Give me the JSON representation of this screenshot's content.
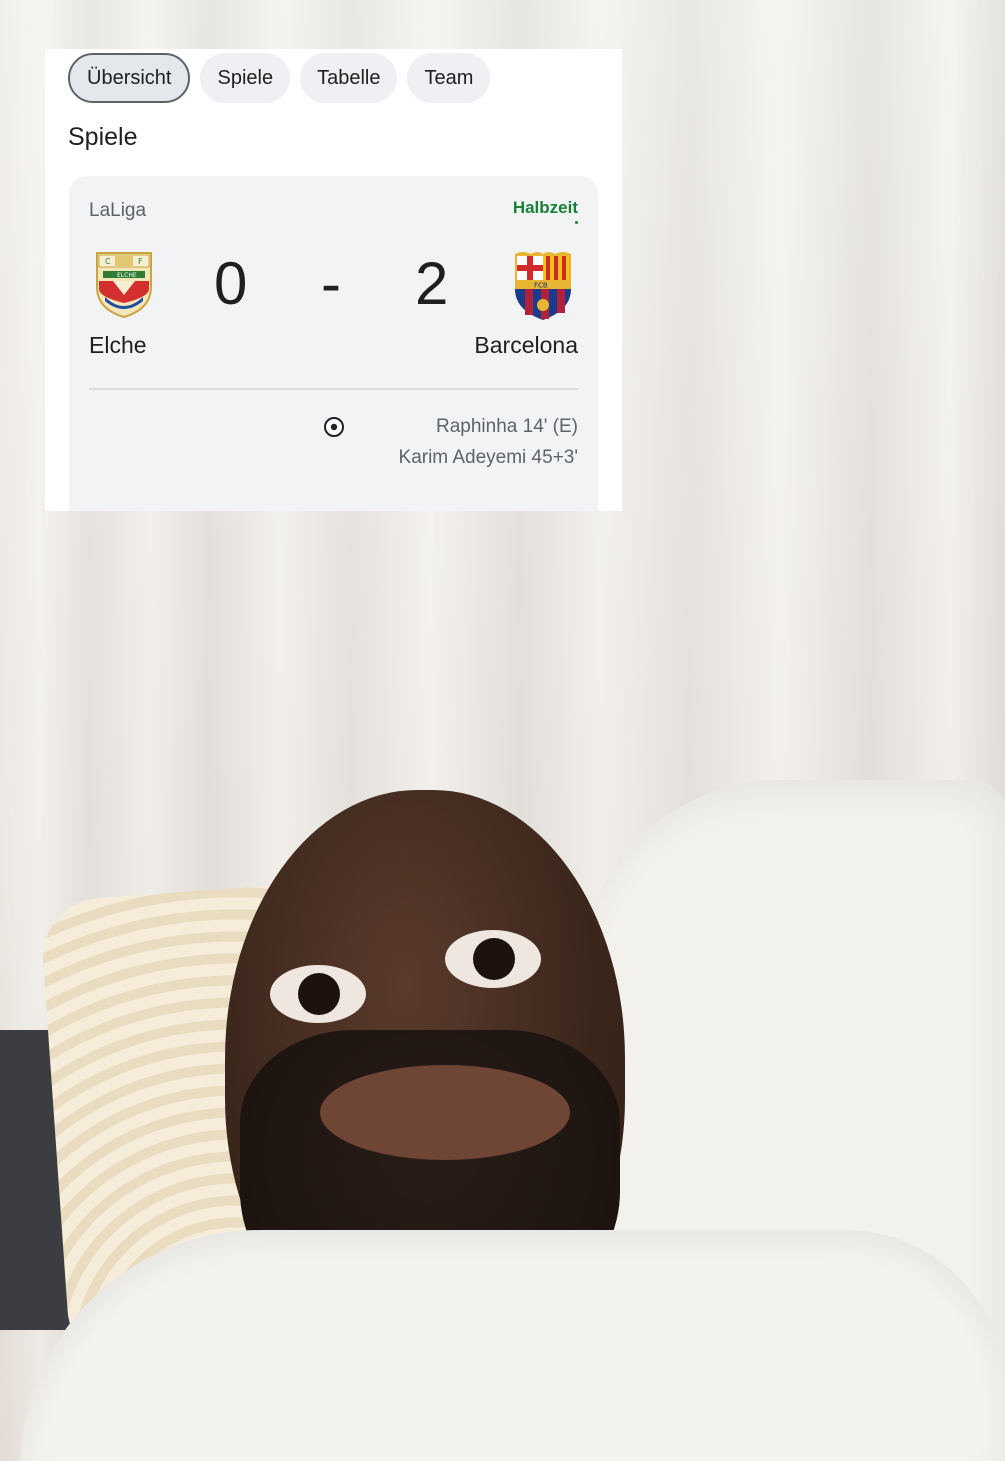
{
  "tabs": [
    {
      "label": "Übersicht",
      "active": true
    },
    {
      "label": "Spiele",
      "active": false
    },
    {
      "label": "Tabelle",
      "active": false
    },
    {
      "label": "Team",
      "active": false
    }
  ],
  "section_title": "Spiele",
  "match": {
    "league": "LaLiga",
    "status": "Halbzeit",
    "home": {
      "name": "Elche",
      "score": "0",
      "crest": "elche-crest-icon"
    },
    "separator": "-",
    "away": {
      "name": "Barcelona",
      "score": "2",
      "crest": "barcelona-crest-icon"
    },
    "scorers": [
      "Raphinha 14' (E)",
      "Karim Adeyemi 45+3'"
    ],
    "goal_icon": "soccer-ball-icon"
  },
  "colors": {
    "status_green": "#188038",
    "card_bg": "#f1f3f5",
    "chip_bg": "#eef0f3"
  }
}
